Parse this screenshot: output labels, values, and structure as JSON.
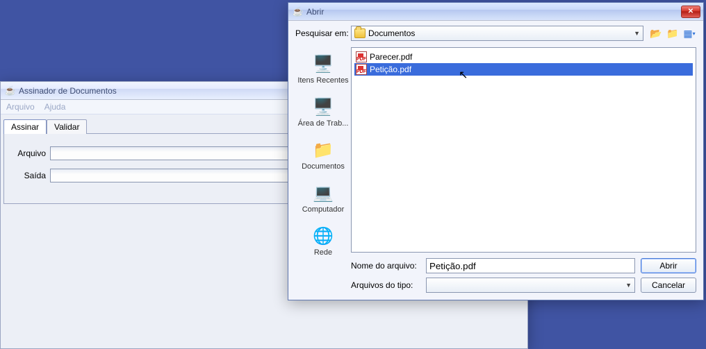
{
  "bg": {},
  "back_window": {
    "title": "Assinador de Documentos",
    "menu": {
      "arquivo": "Arquivo",
      "ajuda": "Ajuda"
    },
    "tabs": {
      "assinar": "Assinar",
      "validar": "Validar"
    },
    "form": {
      "arquivo_label": "Arquivo",
      "arquivo_value": "",
      "saida_label": "Saída",
      "saida_value": ""
    }
  },
  "front_dialog": {
    "title": "Abrir",
    "search_in_label": "Pesquisar em:",
    "location": "Documentos",
    "places": {
      "recent": "Itens Recentes",
      "desktop": "Área de Trab...",
      "documents": "Documentos",
      "computer": "Computador",
      "network": "Rede"
    },
    "files": [
      {
        "name": "Parecer.pdf",
        "selected": false
      },
      {
        "name": "Petição.pdf",
        "selected": true
      }
    ],
    "filename_label": "Nome do arquivo:",
    "filename_value": "Petição.pdf",
    "filetype_label": "Arquivos do tipo:",
    "filetype_value": "",
    "open_btn": "Abrir",
    "cancel_btn": "Cancelar"
  }
}
